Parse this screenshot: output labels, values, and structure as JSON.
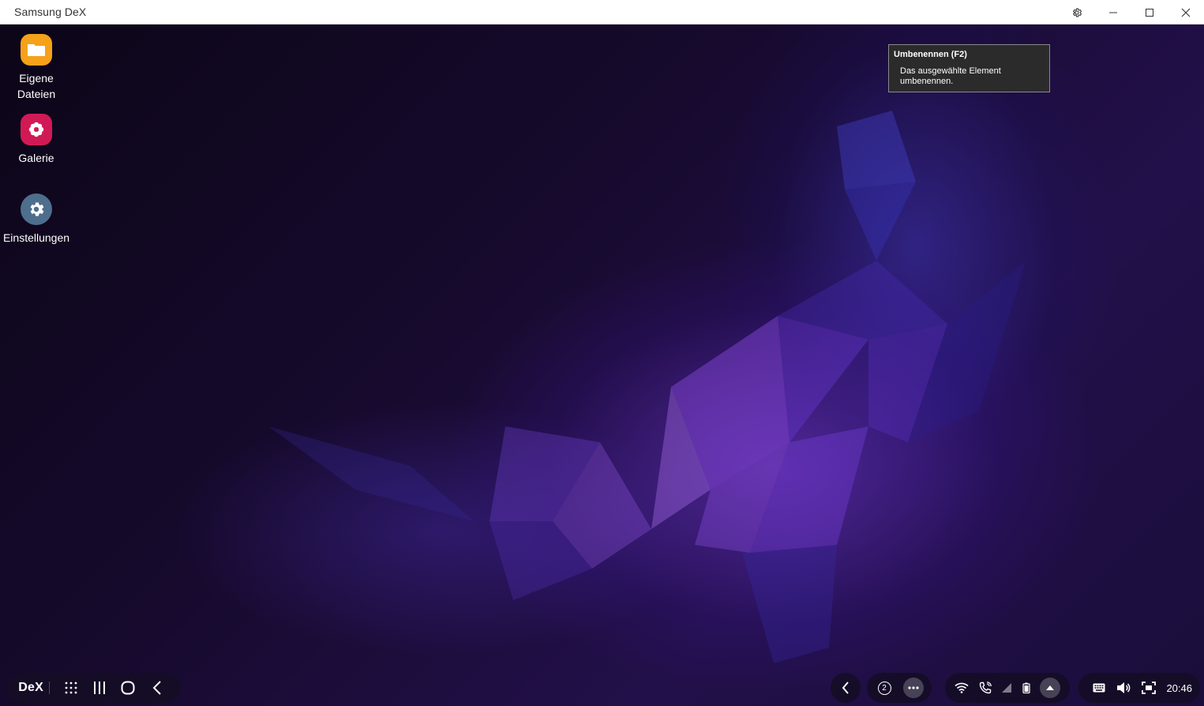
{
  "window": {
    "title": "Samsung DeX",
    "controls": {
      "settings_icon": "gear-icon",
      "minimize_icon": "minimize-icon",
      "maximize_icon": "maximize-icon",
      "close_icon": "close-icon"
    }
  },
  "desktop_icons": [
    {
      "label_line1": "Eigene",
      "label_line2": "Dateien",
      "icon": "folder-icon",
      "color": "#f6a11a"
    },
    {
      "label": "Galerie",
      "icon": "flower-icon",
      "color": "#d11a55"
    },
    {
      "label": "Einstellungen",
      "icon": "gear-icon",
      "color": "#4e6e8e"
    }
  ],
  "tooltip": {
    "title": "Umbenennen (F2)",
    "description_line1": "Das ausgewählte Element",
    "description_line2": "umbenennen."
  },
  "taskbar": {
    "left": {
      "dex_label": "DeX",
      "buttons": [
        "apps-grid-icon",
        "recent-apps-icon",
        "home-icon",
        "back-icon"
      ]
    },
    "center": {
      "back_icon": "chevron-left-icon",
      "badge_count": "2",
      "more_icon": "more-dots-icon"
    },
    "status": [
      "wifi-icon",
      "wifi-call-icon",
      "signal-icon",
      "battery-icon",
      "expand-up-icon"
    ],
    "system": {
      "icons": [
        "keyboard-icon",
        "volume-icon",
        "screenshot-icon"
      ],
      "clock": "20:46"
    }
  },
  "colors": {
    "accent_purple": "#7b3fe4",
    "taskbar_bg": "#140e24"
  }
}
